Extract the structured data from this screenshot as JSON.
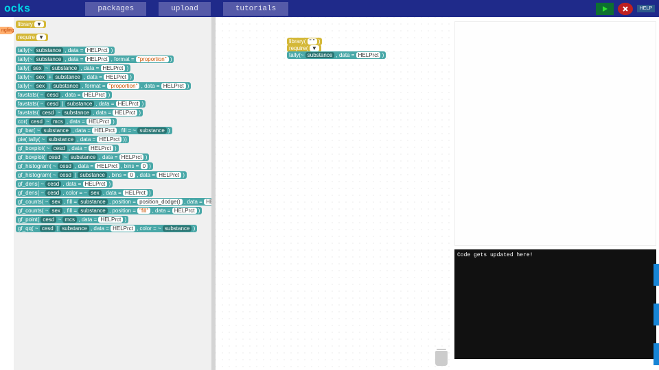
{
  "header": {
    "logo": "ocks",
    "nav": {
      "packages": "packages",
      "upload": "upload",
      "tutorials": "tutorials"
    },
    "help": "HELP"
  },
  "side": {
    "wrangling": "ngling"
  },
  "palette_special": {
    "library": "library",
    "require": "require"
  },
  "canvas_blocks": {
    "library_label": "library(",
    "lib_val": "\" \"",
    "require_label": "require(",
    "tally_label": "tally(~",
    "tally_arg": "substance",
    "tally_data": ", data =",
    "tally_ds": "HELPrct"
  },
  "blocks": [
    "tally(~ <v>substance</v> , data = <w>HELPrct</w> )",
    "tally(~ <v>substance</v> , data = <w>HELPrct</w> , format = <w><q>\"proportion\"</q></w> )",
    "tally( <v>sex</v> ~ <v>substance</v> , data = <w>HELPrct</w> )",
    "tally(~ <v>sex</v> + <v>substance</v> , data = <w>HELPrct</w> )",
    "tally(~ <v>sex</v> | <v>substance</v> , format = <w><q>\"proportion\"</q></w> , data = <w>HELPrct</w> )",
    "favstats( ~ <v>cesd</v> , data = <w>HELPrct</w> )",
    "favstats( ~ <v>cesd</v> | <v>substance</v> , data = <w>HELPrct</w> )",
    "favstats( <v>cesd</v> ~ <v>substance</v> , data = <w>HELPrct</w> )",
    "cor( <v>cesd</v> ~ <v>mcs</v> , data = <w>HELPrct</w> )",
    "gf_bar( ~ <v>substance</v> , data = <w>HELPrct</w> , fill = ~ <v>substance</v> )",
    "pie( tally( ~ <v>substance</v> , data = <w>HELPrct</w> ))",
    "gf_boxplot(  ~ <v>cesd</v> , data = <w>HELPrct</w> )",
    "gf_boxplot( <v>cesd</v> ~ <v>substance</v> , data = <w>HELPrct</w> )",
    "gf_histogram(  ~ <v>cesd</v> , data = <w>HELPrct</w> , bins = <w>0</w> )",
    "gf_histogram(  ~ <v>cesd</v> | <v>substance</v> , bins = <w>0</w> , data = <w>HELPrct</w> )",
    "gf_dens(  ~ <v>cesd</v> , data = <w>HELPrct</w> )",
    "gf_dens(  ~ <v>cesd</v> , color =  ~ <v>sex</v> , data = <w>HELPrct</w> )",
    "gf_counts(  ~ <v>sex</v> , fill = <v>substance</v> , position = <w>position_dodge()</w> , data = <w>HELPrct</w> )",
    "gf_counts(  ~ <v>sex</v> , fill = <v>substance</v> , position = <w><q>\"fill\"</q></w> , data = <w>HELPrct</w> )",
    "gf_point( <v>cesd</v> ~ <v>mcs</v> , data = <w>HELPrct</w> )",
    "gf_qq(  ~ <v>cesd</v> | <v>substance</v> , data = <w>HELPrct</w> , color = ~ <v>substance</v> )"
  ],
  "output": {
    "code_hint": "Code gets updated here!"
  }
}
